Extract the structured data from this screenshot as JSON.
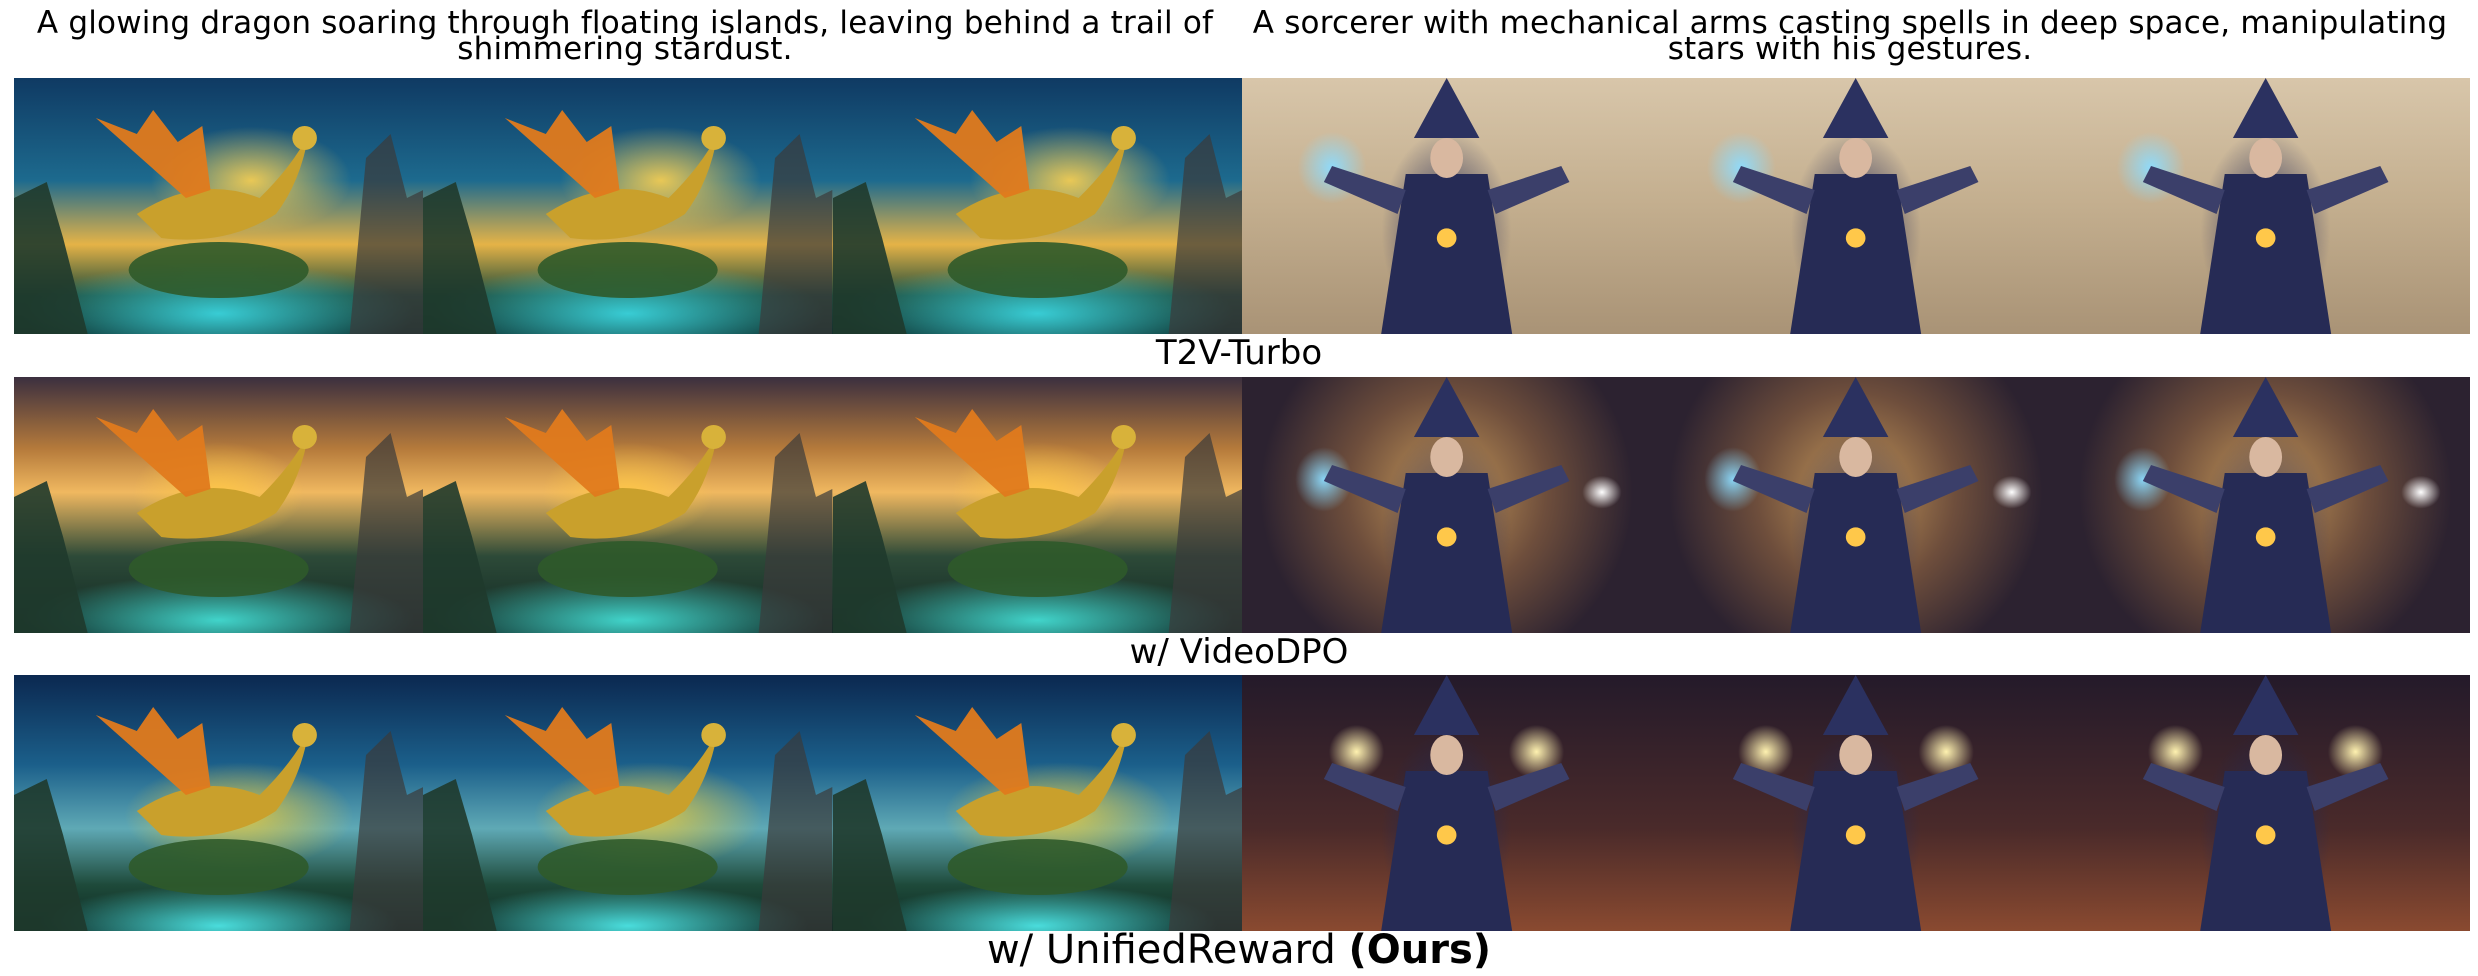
{
  "prompts": {
    "left": "A glowing dragon soaring through floating islands, leaving behind a trail of shimmering stardust.",
    "right": "A sorcerer with mechanical arms casting spells in deep space, manipulating stars with his gestures."
  },
  "rows": [
    {
      "label": "T2V-Turbo"
    },
    {
      "label": "w/ VideoDPO"
    },
    {
      "label_prefix": "w/ UnifiedReward ",
      "label_bold": "(Ours)"
    }
  ],
  "colors": {
    "background": "#ffffff",
    "text": "#000000"
  }
}
